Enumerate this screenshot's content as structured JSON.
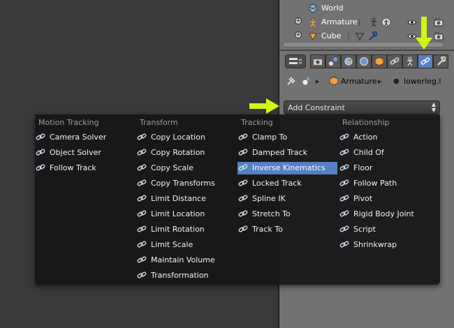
{
  "outliner": {
    "rows": [
      {
        "label": "World",
        "icon": "world-icon"
      },
      {
        "label": "Armature",
        "icon": "armature-icon"
      },
      {
        "label": "Cube",
        "icon": "mesh-icon"
      }
    ]
  },
  "properties": {
    "context_buttons": [
      "render-icon",
      "render-layers-icon",
      "scene-icon",
      "world-icon",
      "object-icon",
      "constraints-icon",
      "object-data-armature-icon",
      "bone-icon",
      "bone-constraints-icon",
      "modifier-icon"
    ],
    "active_context": "bone-constraints-icon",
    "breadcrumb": {
      "object": "Armature",
      "bone": "lowerleg.l"
    },
    "add_constraint_label": "Add Constraint"
  },
  "menu": {
    "columns": [
      {
        "title": "Motion Tracking",
        "items": [
          "Camera Solver",
          "Object Solver",
          "Follow Track"
        ]
      },
      {
        "title": "Transform",
        "items": [
          "Copy Location",
          "Copy Rotation",
          "Copy Scale",
          "Copy Transforms",
          "Limit Distance",
          "Limit Location",
          "Limit Rotation",
          "Limit Scale",
          "Maintain Volume",
          "Transformation"
        ]
      },
      {
        "title": "Tracking",
        "items": [
          "Clamp To",
          "Damped Track",
          "Inverse Kinematics",
          "Locked Track",
          "Spline IK",
          "Stretch To",
          "Track To"
        ]
      },
      {
        "title": "Relationship",
        "items": [
          "Action",
          "Child Of",
          "Floor",
          "Follow Path",
          "Pivot",
          "Rigid Body Joint",
          "Script",
          "Shrinkwrap"
        ]
      }
    ],
    "highlighted": "Inverse Kinematics"
  },
  "colors": {
    "highlight": "#5680c2",
    "arrow": "#d4f514",
    "menu_bg": "#161616"
  }
}
